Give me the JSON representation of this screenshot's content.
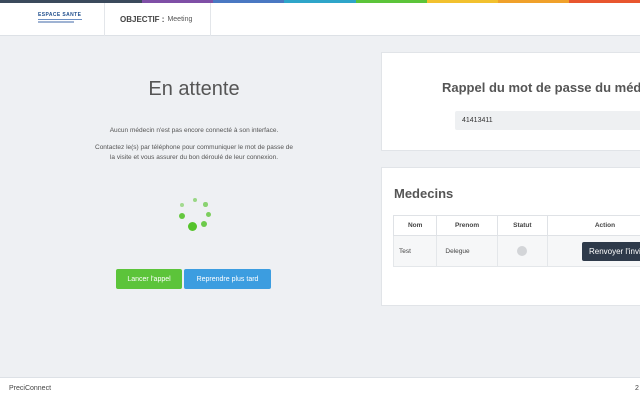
{
  "colors": {
    "rainbow": [
      "#3b4a5c",
      "#3b4a5c",
      "#7f4fa6",
      "#4a78c2",
      "#2ea5c9",
      "#5cc43a",
      "#f2c12e",
      "#f0a12a",
      "#e8562f"
    ],
    "accent_green": "#5cc43a",
    "accent_blue": "#3c9de0",
    "dark_button": "#2e3a4a"
  },
  "header": {
    "logo_text": "ESPACE SANTE",
    "objectif_label": "OBJECTIF :",
    "objectif_value": "Meeting"
  },
  "waiting": {
    "title": "En attente",
    "message": "Aucun médecin n'est pas encore connecté à son interface.",
    "instructions": "Contactez le(s) par téléphone pour communiquer le mot de passe de la visite et vous assurer du bon déroulé de leur connexion.",
    "spinner_icon": "loading-spinner-icon",
    "call_button": "Lancer l'appel",
    "later_button": "Reprendre plus tard"
  },
  "password": {
    "title": "Rappel du mot de passe du médecin",
    "value": "41413411"
  },
  "medecins": {
    "title": "Medecins",
    "columns": [
      "Nom",
      "Prenom",
      "Statut",
      "Action"
    ],
    "rows": [
      {
        "nom": "Test",
        "prenom": "Delegue",
        "statut": "offline",
        "action": "Renvoyer l'invitation"
      }
    ]
  },
  "footer": {
    "brand": "PreciConnect",
    "right": "2"
  }
}
